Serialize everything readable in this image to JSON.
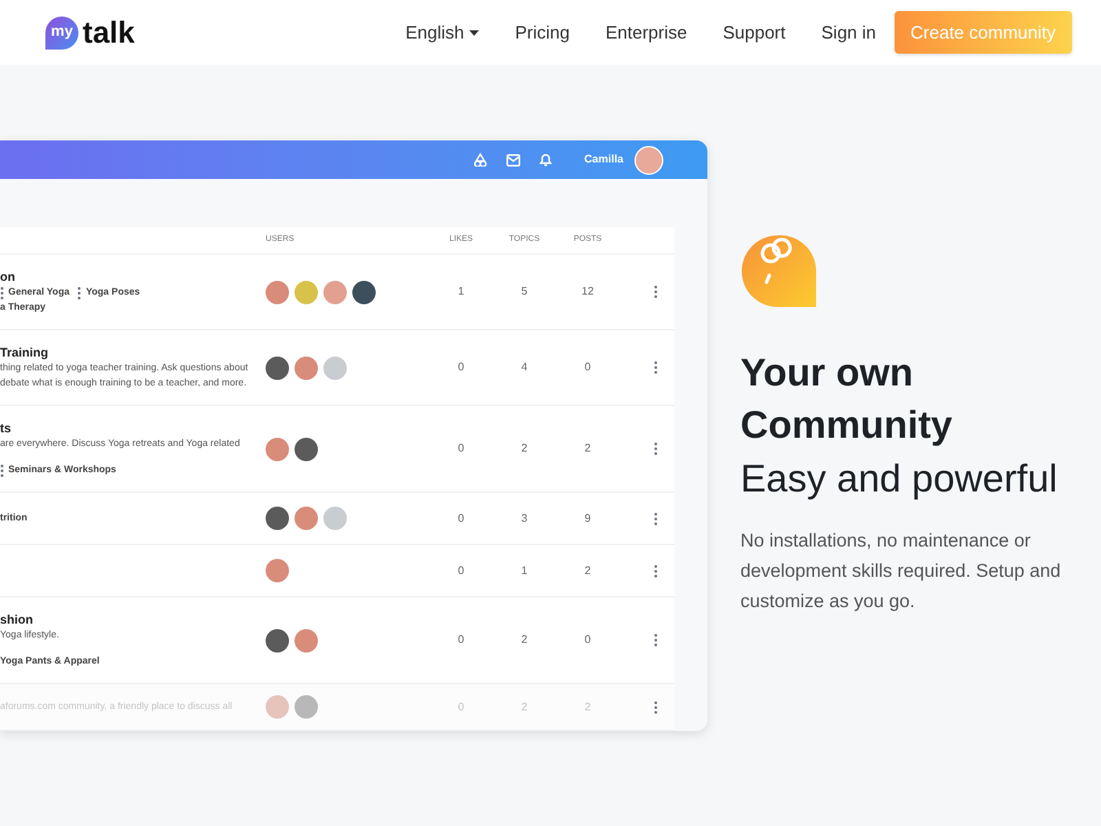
{
  "nav": {
    "logo": {
      "badge": "my",
      "text": "talk"
    },
    "links": [
      {
        "label": "English",
        "kind": "dropdown"
      },
      {
        "label": "Pricing",
        "kind": "link"
      },
      {
        "label": "Enterprise",
        "kind": "link"
      },
      {
        "label": "Support",
        "kind": "link"
      },
      {
        "label": "Sign in",
        "kind": "link"
      }
    ],
    "cta": "Create community"
  },
  "app": {
    "user": {
      "name": "Camilla"
    },
    "columns": [
      "USERS",
      "LIKES",
      "TOPICS",
      "POSTS"
    ],
    "rows": [
      {
        "title": "on",
        "description": [],
        "tag_lines": [
          [
            {
              "label": "General Yoga",
              "separator": true
            },
            {
              "label": "Yoga Poses",
              "separator": true
            }
          ],
          [
            {
              "label": "a Therapy",
              "separator": false
            }
          ]
        ],
        "users": [
          {
            "color": "#d98c7a"
          },
          {
            "color": "#d8c24a"
          },
          {
            "color": "#e3a090"
          },
          {
            "color": "#3d4f5c"
          }
        ],
        "likes": "1",
        "topics": "5",
        "posts": "12",
        "faded": false
      },
      {
        "title": "Training",
        "description": [
          "thing related to yoga teacher training. Ask questions about",
          "debate what is enough training to be a teacher, and more."
        ],
        "tag_lines": [],
        "users": [
          {
            "color": "#5b5b5b"
          },
          {
            "color": "#d98c7a"
          },
          {
            "color": "#c9ccd0"
          }
        ],
        "likes": "0",
        "topics": "4",
        "posts": "0",
        "faded": false
      },
      {
        "title": "ts",
        "description": [
          "are everywhere. Discuss Yoga retreats and Yoga related"
        ],
        "tag_lines": [
          [
            {
              "label": "Seminars & Workshops",
              "separator": true
            }
          ]
        ],
        "users": [
          {
            "color": "#d98c7a"
          },
          {
            "color": "#5b5b5b"
          }
        ],
        "likes": "0",
        "topics": "2",
        "posts": "2",
        "faded": false
      },
      {
        "title": "",
        "description": [],
        "tag_lines": [
          [
            {
              "label": "trition",
              "separator": false
            }
          ]
        ],
        "users": [
          {
            "color": "#5b5b5b"
          },
          {
            "color": "#d98c7a"
          },
          {
            "color": "#c9ccd0"
          }
        ],
        "likes": "0",
        "topics": "3",
        "posts": "9",
        "faded": false
      },
      {
        "title": "",
        "description": [],
        "tag_lines": [],
        "users": [
          {
            "color": "#d98c7a"
          }
        ],
        "likes": "0",
        "topics": "1",
        "posts": "2",
        "faded": false
      },
      {
        "title": "shion",
        "description": [
          "Yoga lifestyle."
        ],
        "tag_lines": [
          [
            {
              "label": "Yoga Pants & Apparel",
              "separator": false
            }
          ]
        ],
        "users": [
          {
            "color": "#5b5b5b"
          },
          {
            "color": "#d98c7a"
          }
        ],
        "likes": "0",
        "topics": "2",
        "posts": "0",
        "faded": false
      },
      {
        "title": "",
        "description": [
          "aforums.com community, a friendly place to discuss all"
        ],
        "tag_lines": [],
        "users": [
          {
            "color": "#e6c4bc"
          },
          {
            "color": "#b8b8b8"
          }
        ],
        "likes": "0",
        "topics": "2",
        "posts": "2",
        "faded": true
      }
    ]
  },
  "hero": {
    "title": "Your own Community",
    "subtitle": "Easy and powerful",
    "text": "No installations, no maintenance or development skills required. Setup and customize as you go."
  }
}
